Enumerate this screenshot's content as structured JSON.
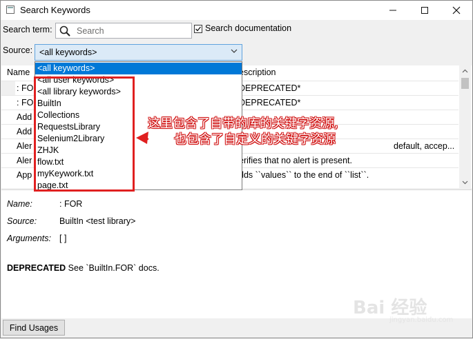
{
  "window": {
    "title": "Search Keywords"
  },
  "search": {
    "label": "Search term:",
    "placeholder": "Search",
    "doc_checkbox_label": "Search documentation",
    "doc_checked": true
  },
  "source": {
    "label": "Source:",
    "selected": "<all keywords>",
    "options": [
      "<all keywords>",
      "<all user keywords>",
      "<all library keywords>",
      "BuiltIn",
      "Collections",
      "RequestsLibrary",
      "Selenium2Library",
      "ZHJK",
      "flow.txt",
      "myKeywork.txt",
      "page.txt"
    ]
  },
  "table": {
    "headers": {
      "name": "Name",
      "description": "Description"
    },
    "header_visible": {
      "name": "Name",
      "description": "escription"
    },
    "rows": [
      {
        "name": ": FOR",
        "description": "DEPRECATED*"
      },
      {
        "name": ": FOR",
        "description": "DEPRECATED*"
      },
      {
        "name": "Add",
        "description": ""
      },
      {
        "name": "Add",
        "description": ""
      },
      {
        "name": "Aler",
        "description": "default, accep..."
      },
      {
        "name": "Aler",
        "description": "erifies that no alert is present."
      },
      {
        "name": "App",
        "description": "dds ``values`` to the end of ``list``."
      }
    ]
  },
  "details": {
    "name_label": "Name:",
    "name_value": ": FOR",
    "source_label": "Source:",
    "source_value": "BuiltIn <test library>",
    "arguments_label": "Arguments:",
    "arguments_value": "[ ]",
    "doc_bold": "DEPRECATED",
    "doc_text": " See `BuiltIn.FOR` docs."
  },
  "buttons": {
    "find_usages": "Find Usages"
  },
  "annotation": {
    "line1": "这里包含了自带的库的关键字资源,",
    "line2": "也包含了自定义的关键字资源"
  },
  "watermark": {
    "text": "Bai 经验",
    "sub": "jingyan.baidu.com"
  },
  "colors": {
    "selection": "#0078d7",
    "annotation_red": "#e02020",
    "select_bg": "#dbeaf7"
  }
}
